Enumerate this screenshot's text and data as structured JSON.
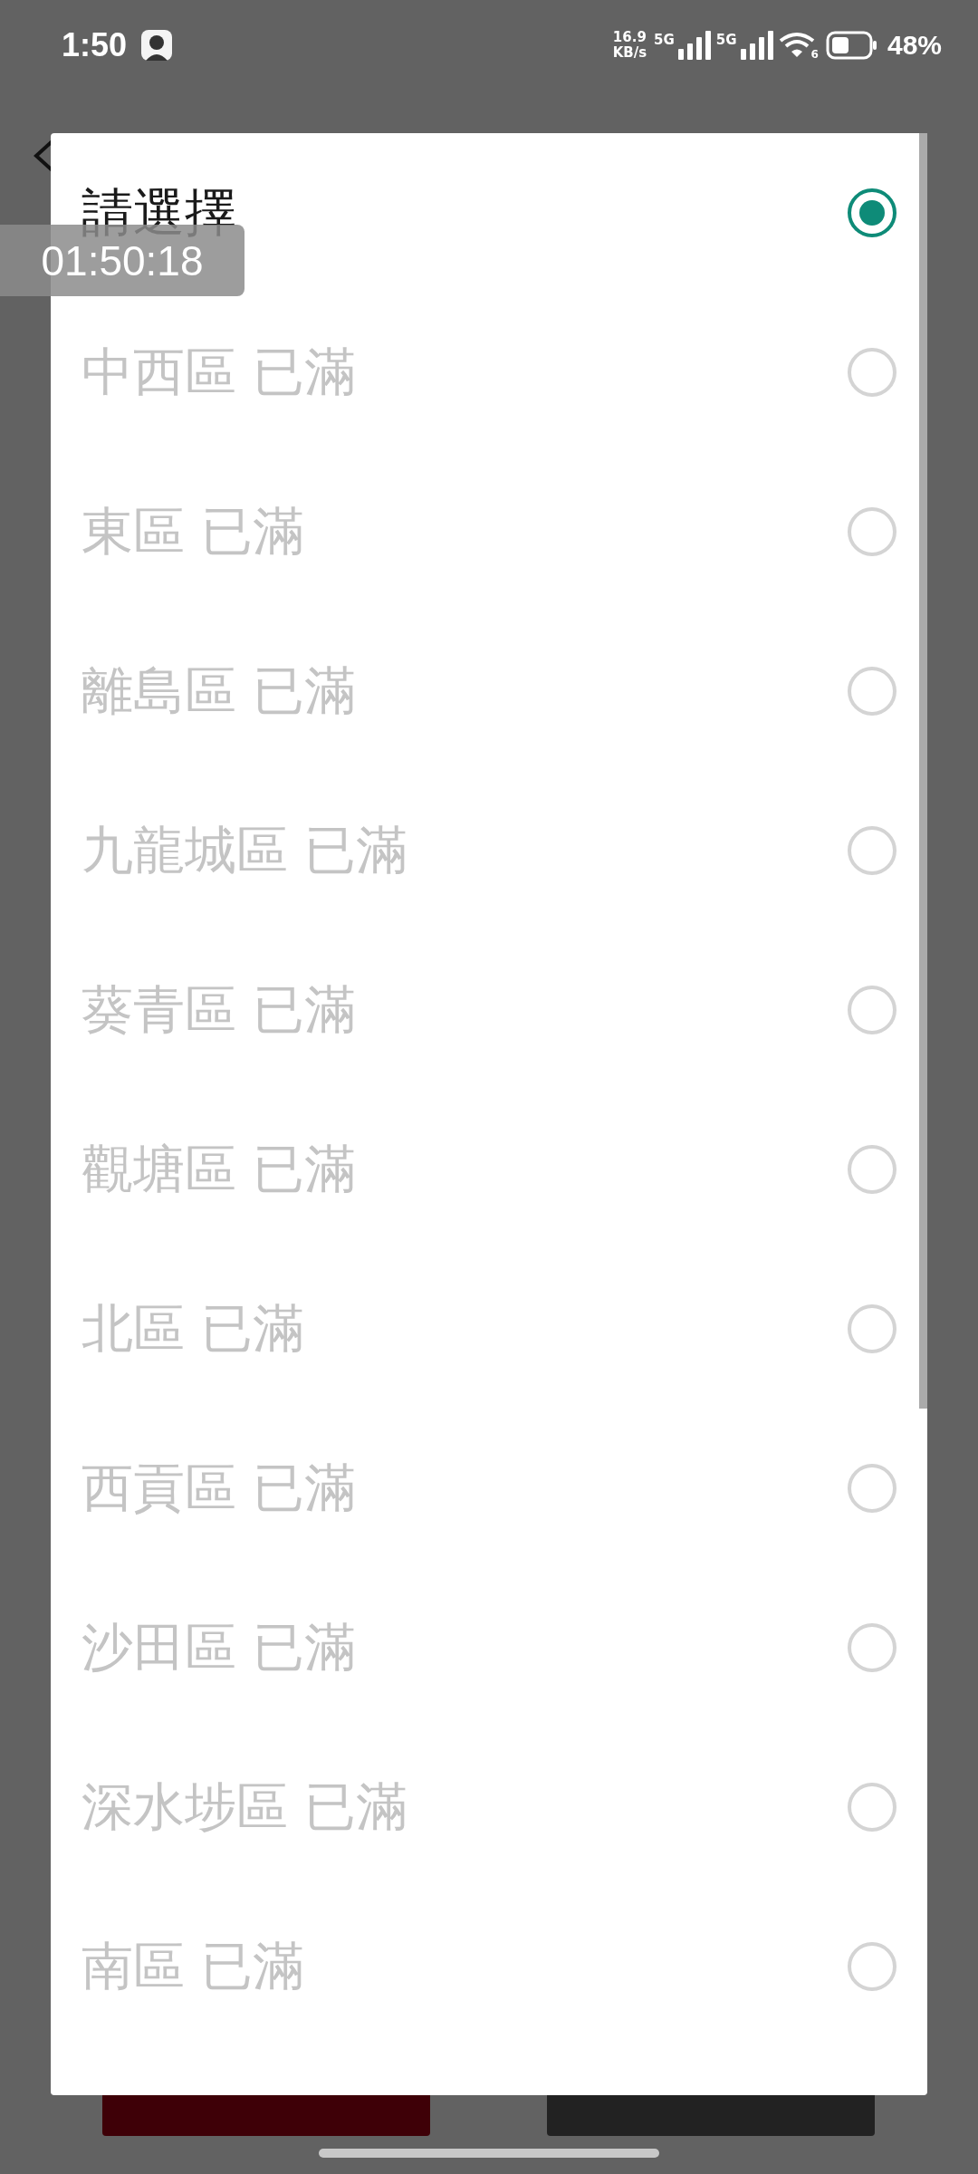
{
  "status_bar": {
    "time": "1:50",
    "net_speed": "16.9",
    "net_unit": "KB/s",
    "sim1": "5G",
    "sim2": "5G",
    "wifi_band": "6",
    "battery": "48%"
  },
  "recording_timer": "01:50:18",
  "options": [
    {
      "label": "請選擇",
      "selected": true,
      "disabled": false
    },
    {
      "label": "中西區 已滿",
      "selected": false,
      "disabled": true
    },
    {
      "label": "東區 已滿",
      "selected": false,
      "disabled": true
    },
    {
      "label": "離島區 已滿",
      "selected": false,
      "disabled": true
    },
    {
      "label": "九龍城區 已滿",
      "selected": false,
      "disabled": true
    },
    {
      "label": "葵青區 已滿",
      "selected": false,
      "disabled": true
    },
    {
      "label": "觀塘區 已滿",
      "selected": false,
      "disabled": true
    },
    {
      "label": "北區 已滿",
      "selected": false,
      "disabled": true
    },
    {
      "label": "西貢區 已滿",
      "selected": false,
      "disabled": true
    },
    {
      "label": "沙田區 已滿",
      "selected": false,
      "disabled": true
    },
    {
      "label": "深水埗區 已滿",
      "selected": false,
      "disabled": true
    },
    {
      "label": "南區 已滿",
      "selected": false,
      "disabled": true
    }
  ]
}
